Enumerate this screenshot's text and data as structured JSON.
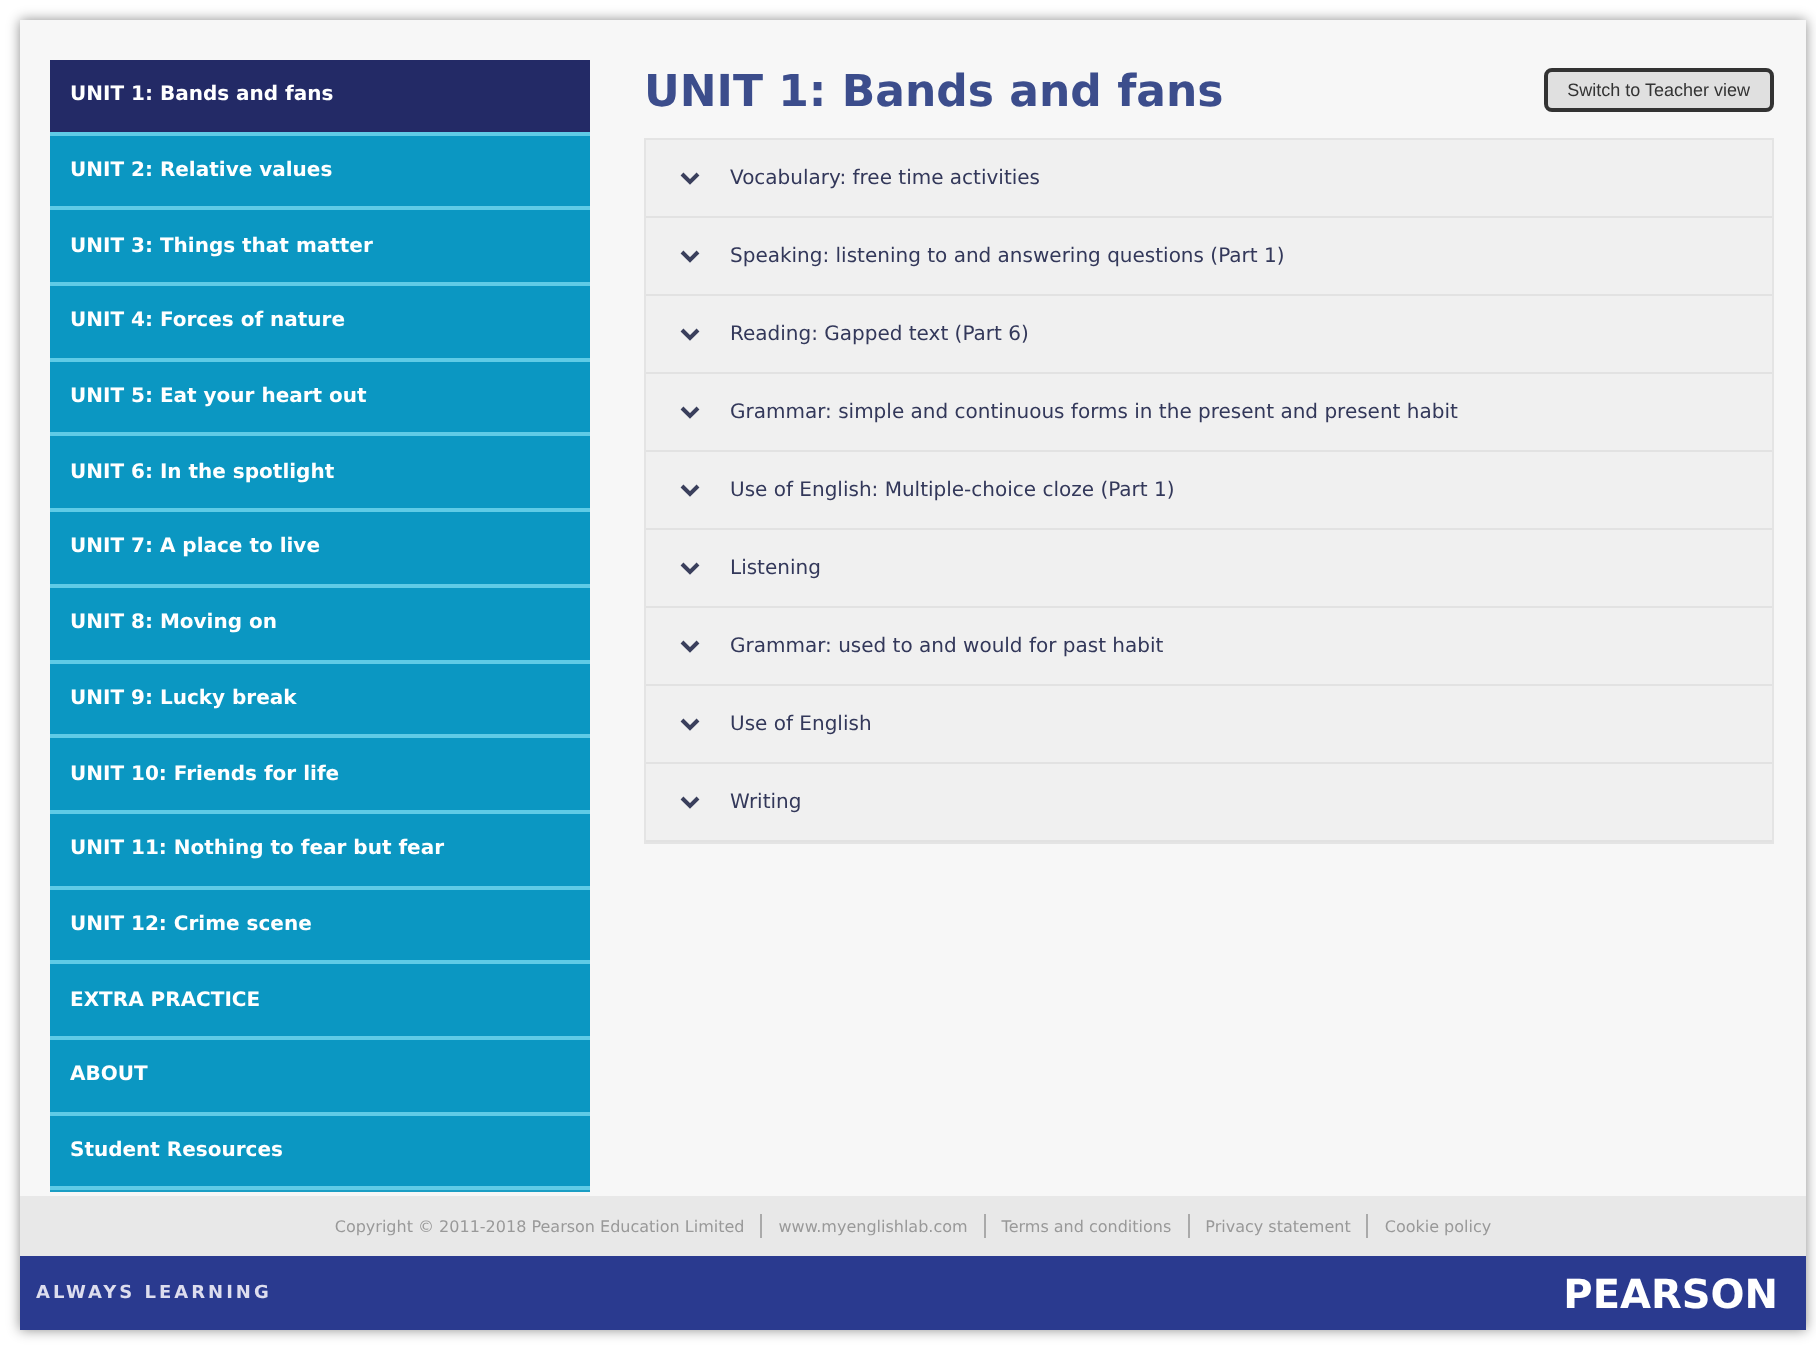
{
  "sidebar": {
    "items": [
      {
        "label": "UNIT 1: Bands and fans",
        "selected": true
      },
      {
        "label": "UNIT 2: Relative values",
        "selected": false
      },
      {
        "label": "UNIT 3: Things that matter",
        "selected": false
      },
      {
        "label": "UNIT 4: Forces of nature",
        "selected": false
      },
      {
        "label": "UNIT 5: Eat your heart out",
        "selected": false
      },
      {
        "label": "UNIT 6: In the spotlight",
        "selected": false
      },
      {
        "label": "UNIT 7: A place to live",
        "selected": false
      },
      {
        "label": "UNIT 8: Moving on",
        "selected": false
      },
      {
        "label": "UNIT 9: Lucky break",
        "selected": false
      },
      {
        "label": "UNIT 10: Friends for life",
        "selected": false
      },
      {
        "label": "UNIT 11: Nothing to fear but fear",
        "selected": false
      },
      {
        "label": "UNIT 12: Crime scene",
        "selected": false
      },
      {
        "label": "EXTRA PRACTICE",
        "selected": false
      },
      {
        "label": "ABOUT",
        "selected": false
      },
      {
        "label": "Student Resources",
        "selected": false
      }
    ]
  },
  "main": {
    "title": "UNIT 1: Bands and fans",
    "teacher_button": "Switch to Teacher view",
    "sections": [
      {
        "label": "Vocabulary: free time activities",
        "expanded": false
      },
      {
        "label": "Speaking: listening to and answering questions (Part 1)",
        "expanded": false
      },
      {
        "label": "Reading: Gapped text (Part 6)",
        "expanded": false
      },
      {
        "label": "Grammar: simple and continuous forms in the present and present habit",
        "expanded": false
      },
      {
        "label": "Use of English: Multiple-choice cloze (Part 1)",
        "expanded": false
      },
      {
        "label": "Listening",
        "expanded": false
      },
      {
        "label": "Grammar: used to and would for past habit",
        "expanded": false
      },
      {
        "label": "Use of English",
        "expanded": false
      },
      {
        "label": "Writing",
        "expanded": false
      }
    ]
  },
  "footer": {
    "links": [
      "Copyright © 2011-2018 Pearson Education Limited",
      "www.myenglishlab.com",
      "Terms and conditions",
      "Privacy statement",
      "Cookie policy"
    ],
    "tagline": "ALWAYS LEARNING",
    "brand": "PEARSON"
  }
}
